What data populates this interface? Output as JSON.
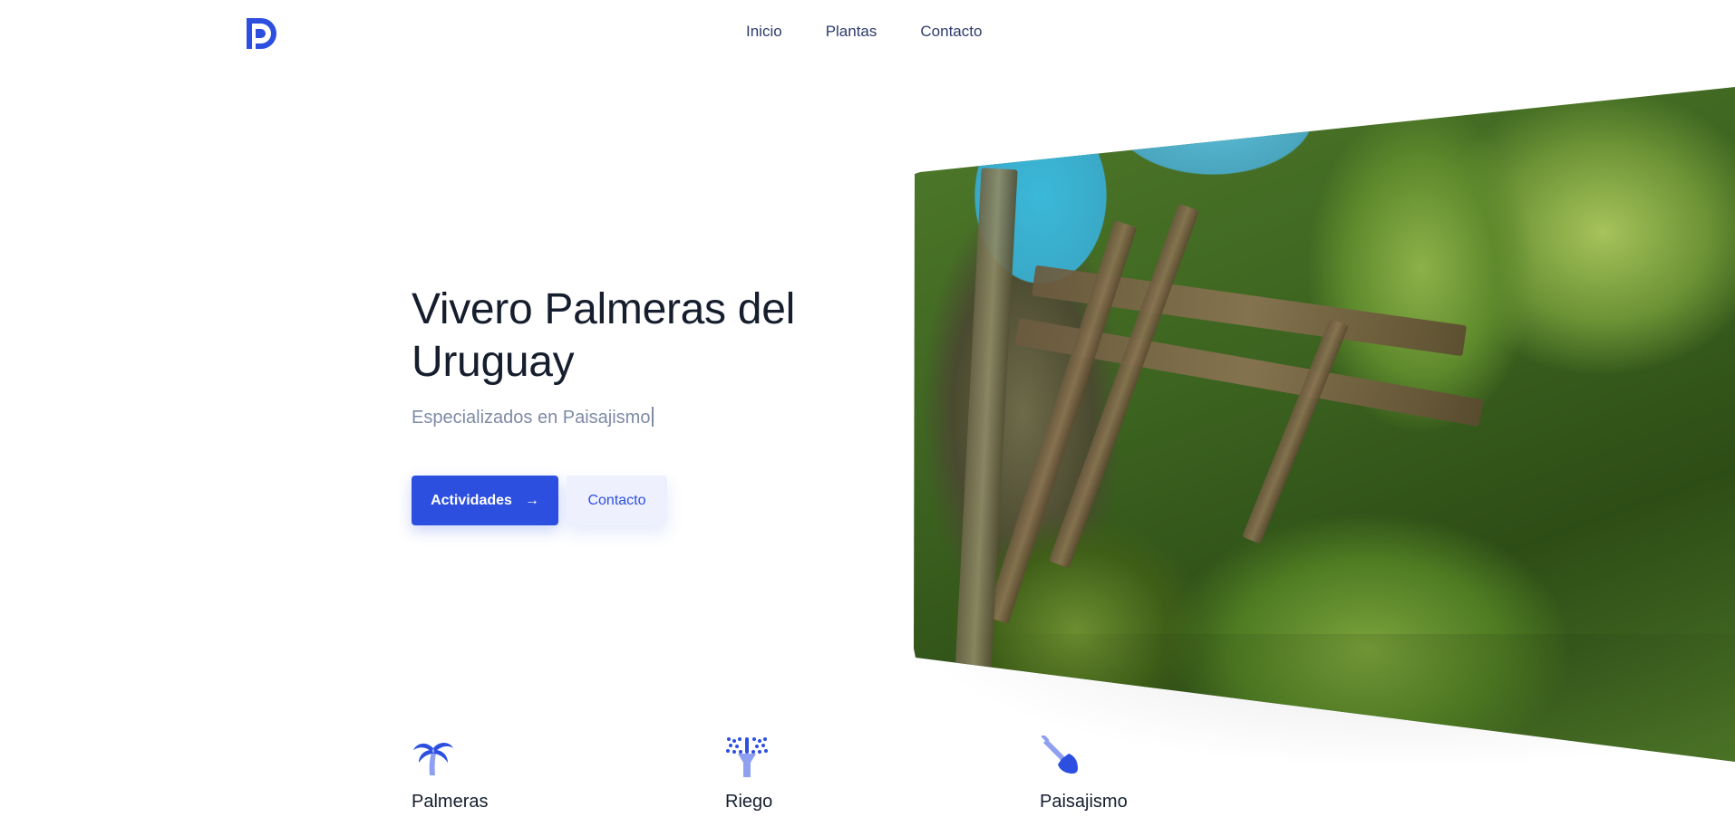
{
  "header": {
    "logo_icon": "brand-logo-icon",
    "nav": [
      {
        "label": "Inicio"
      },
      {
        "label": "Plantas"
      },
      {
        "label": "Contacto"
      }
    ]
  },
  "hero": {
    "title": "Vivero Palmeras del Uruguay",
    "subtitle": "Especializados en Paisajismo",
    "primary_button": {
      "label": "Actividades",
      "icon": "arrow-right-icon"
    },
    "secondary_button": {
      "label": "Contacto"
    },
    "image": "garden-pergola-palms-photo"
  },
  "features": [
    {
      "label": "Palmeras",
      "icon": "palm-tree-icon"
    },
    {
      "label": "Riego",
      "icon": "sprinkler-icon"
    },
    {
      "label": "Paisajismo",
      "icon": "shovel-icon"
    }
  ],
  "colors": {
    "accent": "#2d4fe0",
    "accent_light": "#8fa0f0",
    "text": "#161e2e",
    "muted": "#7e8ba6"
  }
}
